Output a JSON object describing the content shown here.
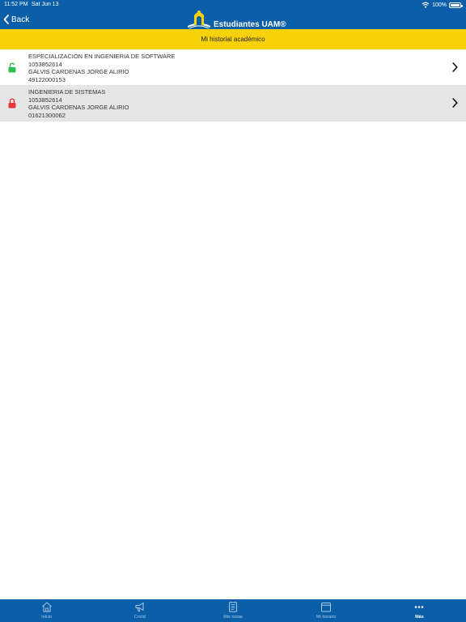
{
  "status_bar": {
    "time": "11:52 PM",
    "date": "Sat Jun 13",
    "battery": "100%"
  },
  "nav": {
    "back_label": "Back",
    "app_name": "Estudiantes UAM®"
  },
  "banner": {
    "title": "Mi historial académico"
  },
  "records": [
    {
      "program": "ESPECIALIZACION EN INGENIERIA DE SOFTWARE",
      "student_id": "1053852614",
      "student_name": "GALVIS CARDENAS JORGE ALIRIO",
      "code": "49122000153",
      "lock_state": "unlocked",
      "lock_color": "#2fbf4f"
    },
    {
      "program": "INGENIERIA DE SISTEMAS",
      "student_id": "1053852614",
      "student_name": "GALVIS CARDENAS JORGE ALIRIO",
      "code": "01621300062",
      "lock_state": "locked",
      "lock_color": "#e53935"
    }
  ],
  "tabs": [
    {
      "label": "Inicio",
      "icon": "home-icon",
      "active": false
    },
    {
      "label": "Covid",
      "icon": "megaphone-icon",
      "active": false
    },
    {
      "label": "Mis notas",
      "icon": "notes-icon",
      "active": false
    },
    {
      "label": "Mi horario",
      "icon": "calendar-icon",
      "active": false
    },
    {
      "label": "Más",
      "icon": "more-icon",
      "active": true
    }
  ],
  "colors": {
    "nav_blue": "#0b5fa8",
    "banner_yellow": "#f7d20a",
    "row_alt": "#e6e6e6"
  }
}
